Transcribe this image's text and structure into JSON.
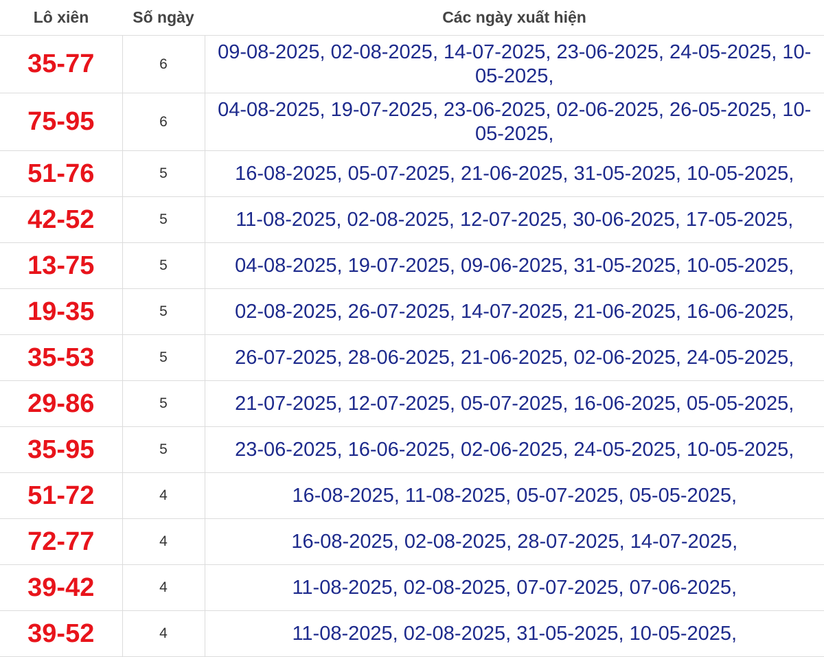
{
  "table": {
    "headers": {
      "pair": "Lô xiên",
      "days": "Số ngày",
      "dates": "Các ngày xuất hiện"
    },
    "rows": [
      {
        "pair": "35-77",
        "days": "6",
        "dates": "09-08-2025, 02-08-2025, 14-07-2025, 23-06-2025, 24-05-2025, 10-05-2025,"
      },
      {
        "pair": "75-95",
        "days": "6",
        "dates": "04-08-2025, 19-07-2025, 23-06-2025, 02-06-2025, 26-05-2025, 10-05-2025,"
      },
      {
        "pair": "51-76",
        "days": "5",
        "dates": "16-08-2025, 05-07-2025, 21-06-2025, 31-05-2025, 10-05-2025,"
      },
      {
        "pair": "42-52",
        "days": "5",
        "dates": "11-08-2025, 02-08-2025, 12-07-2025, 30-06-2025, 17-05-2025,"
      },
      {
        "pair": "13-75",
        "days": "5",
        "dates": "04-08-2025, 19-07-2025, 09-06-2025, 31-05-2025, 10-05-2025,"
      },
      {
        "pair": "19-35",
        "days": "5",
        "dates": "02-08-2025, 26-07-2025, 14-07-2025, 21-06-2025, 16-06-2025,"
      },
      {
        "pair": "35-53",
        "days": "5",
        "dates": "26-07-2025, 28-06-2025, 21-06-2025, 02-06-2025, 24-05-2025,"
      },
      {
        "pair": "29-86",
        "days": "5",
        "dates": "21-07-2025, 12-07-2025, 05-07-2025, 16-06-2025, 05-05-2025,"
      },
      {
        "pair": "35-95",
        "days": "5",
        "dates": "23-06-2025, 16-06-2025, 02-06-2025, 24-05-2025, 10-05-2025,"
      },
      {
        "pair": "51-72",
        "days": "4",
        "dates": "16-08-2025, 11-08-2025, 05-07-2025, 05-05-2025,"
      },
      {
        "pair": "72-77",
        "days": "4",
        "dates": "16-08-2025, 02-08-2025, 28-07-2025, 14-07-2025,"
      },
      {
        "pair": "39-42",
        "days": "4",
        "dates": "11-08-2025, 02-08-2025, 07-07-2025, 07-06-2025,"
      },
      {
        "pair": "39-52",
        "days": "4",
        "dates": "11-08-2025, 02-08-2025, 31-05-2025, 10-05-2025,"
      }
    ]
  },
  "colors": {
    "pair_text": "#e8141b",
    "date_text": "#1d2a8c",
    "header_text": "#444444",
    "grid_line": "#dcdcdc"
  }
}
